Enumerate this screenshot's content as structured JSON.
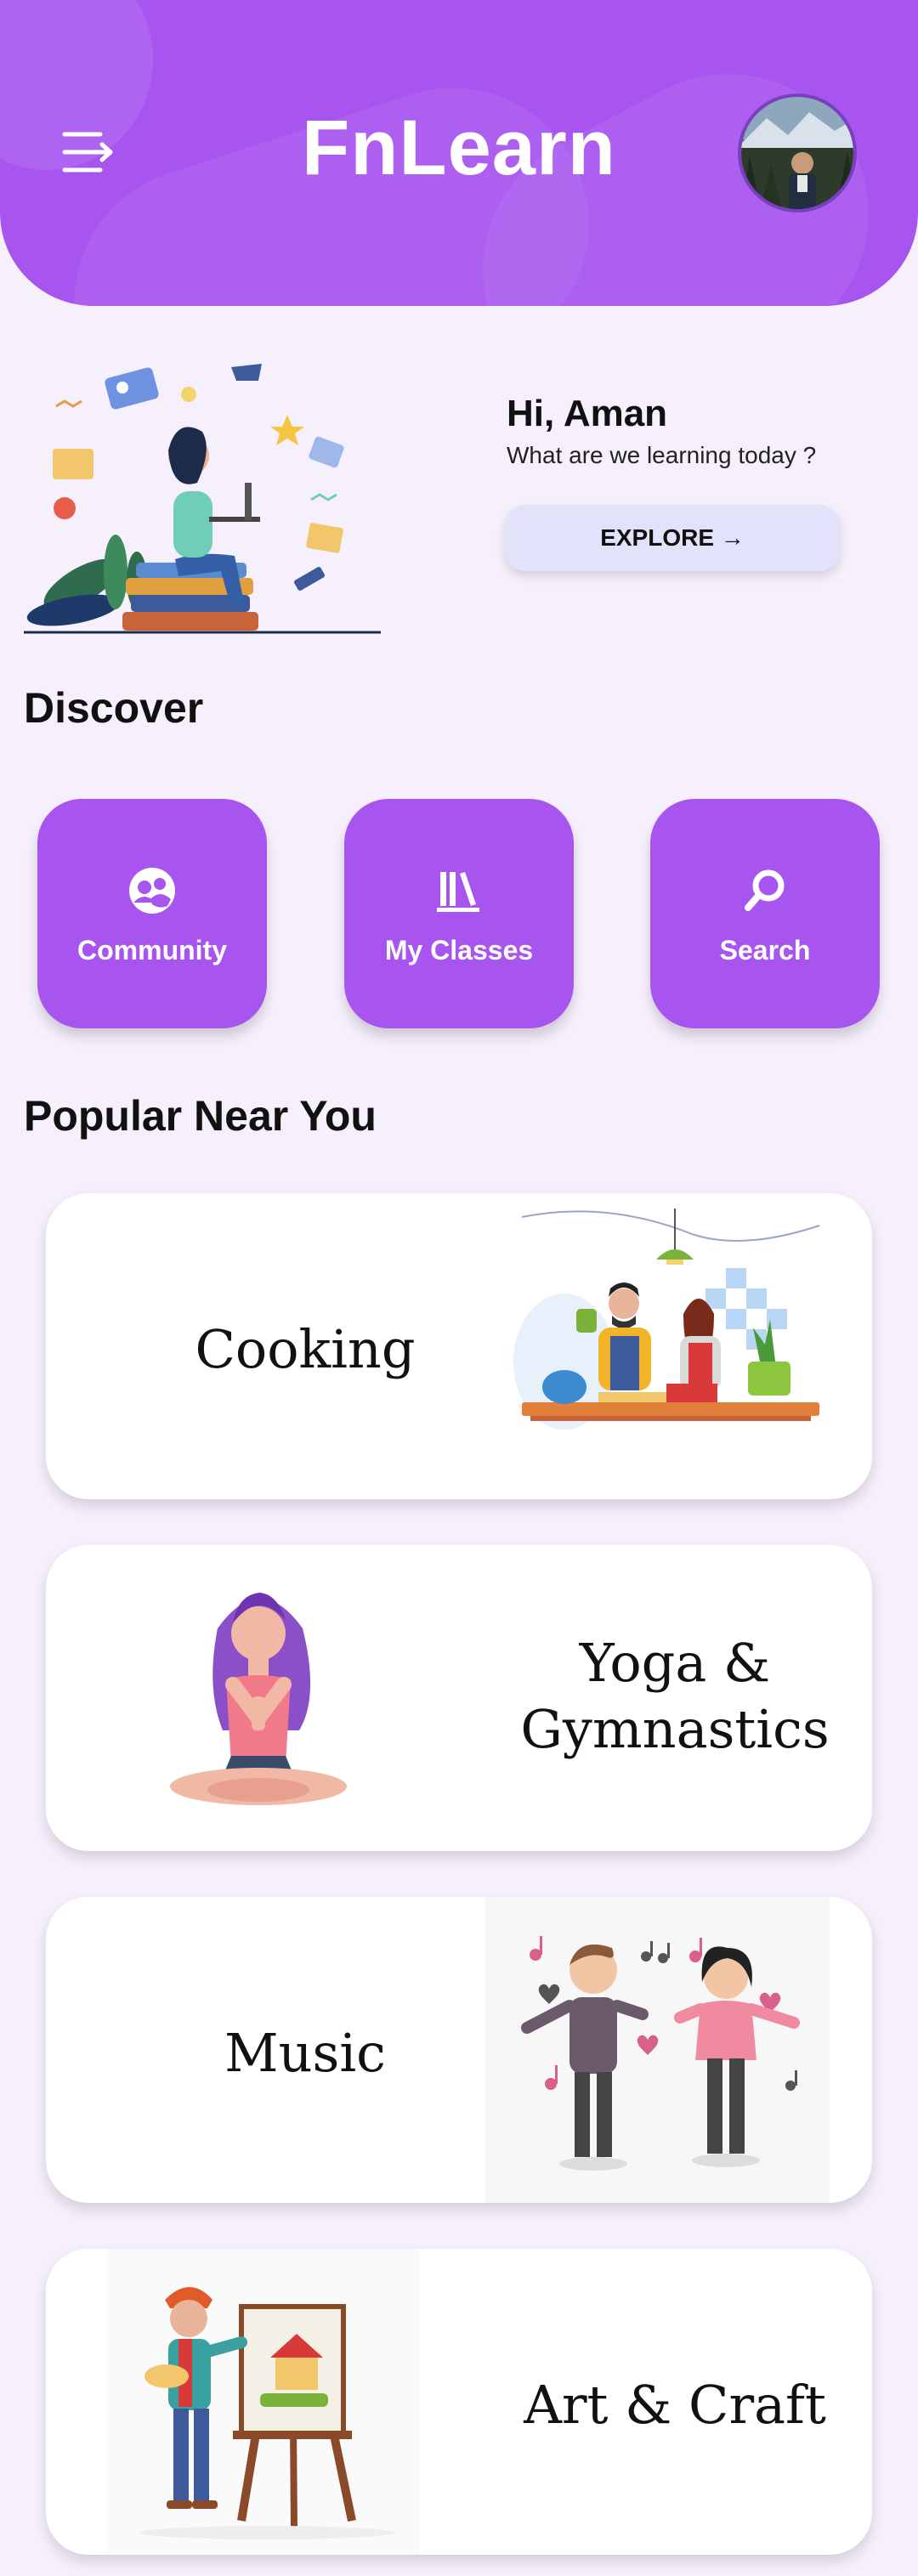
{
  "header": {
    "title": "FnLearn",
    "menu_icon": "menu-icon",
    "avatar": "user-avatar"
  },
  "greeting": {
    "name": "Hi, Aman",
    "subtitle": "What are we learning today ?",
    "explore_label": "EXPLORE →"
  },
  "discover": {
    "title": "Discover",
    "items": [
      {
        "label": "Community",
        "icon": "community-icon"
      },
      {
        "label": "My Classes",
        "icon": "books-icon"
      },
      {
        "label": "Search",
        "icon": "search-icon"
      }
    ]
  },
  "popular": {
    "title": "Popular Near You",
    "cards": [
      {
        "label": "Cooking"
      },
      {
        "label": "Yoga & Gymnastics"
      },
      {
        "label": "Music"
      },
      {
        "label": "Art & Craft"
      }
    ]
  },
  "colors": {
    "primary": "#a855f0",
    "background": "#f6f0fd",
    "explore_button": "#e2e3fb"
  }
}
